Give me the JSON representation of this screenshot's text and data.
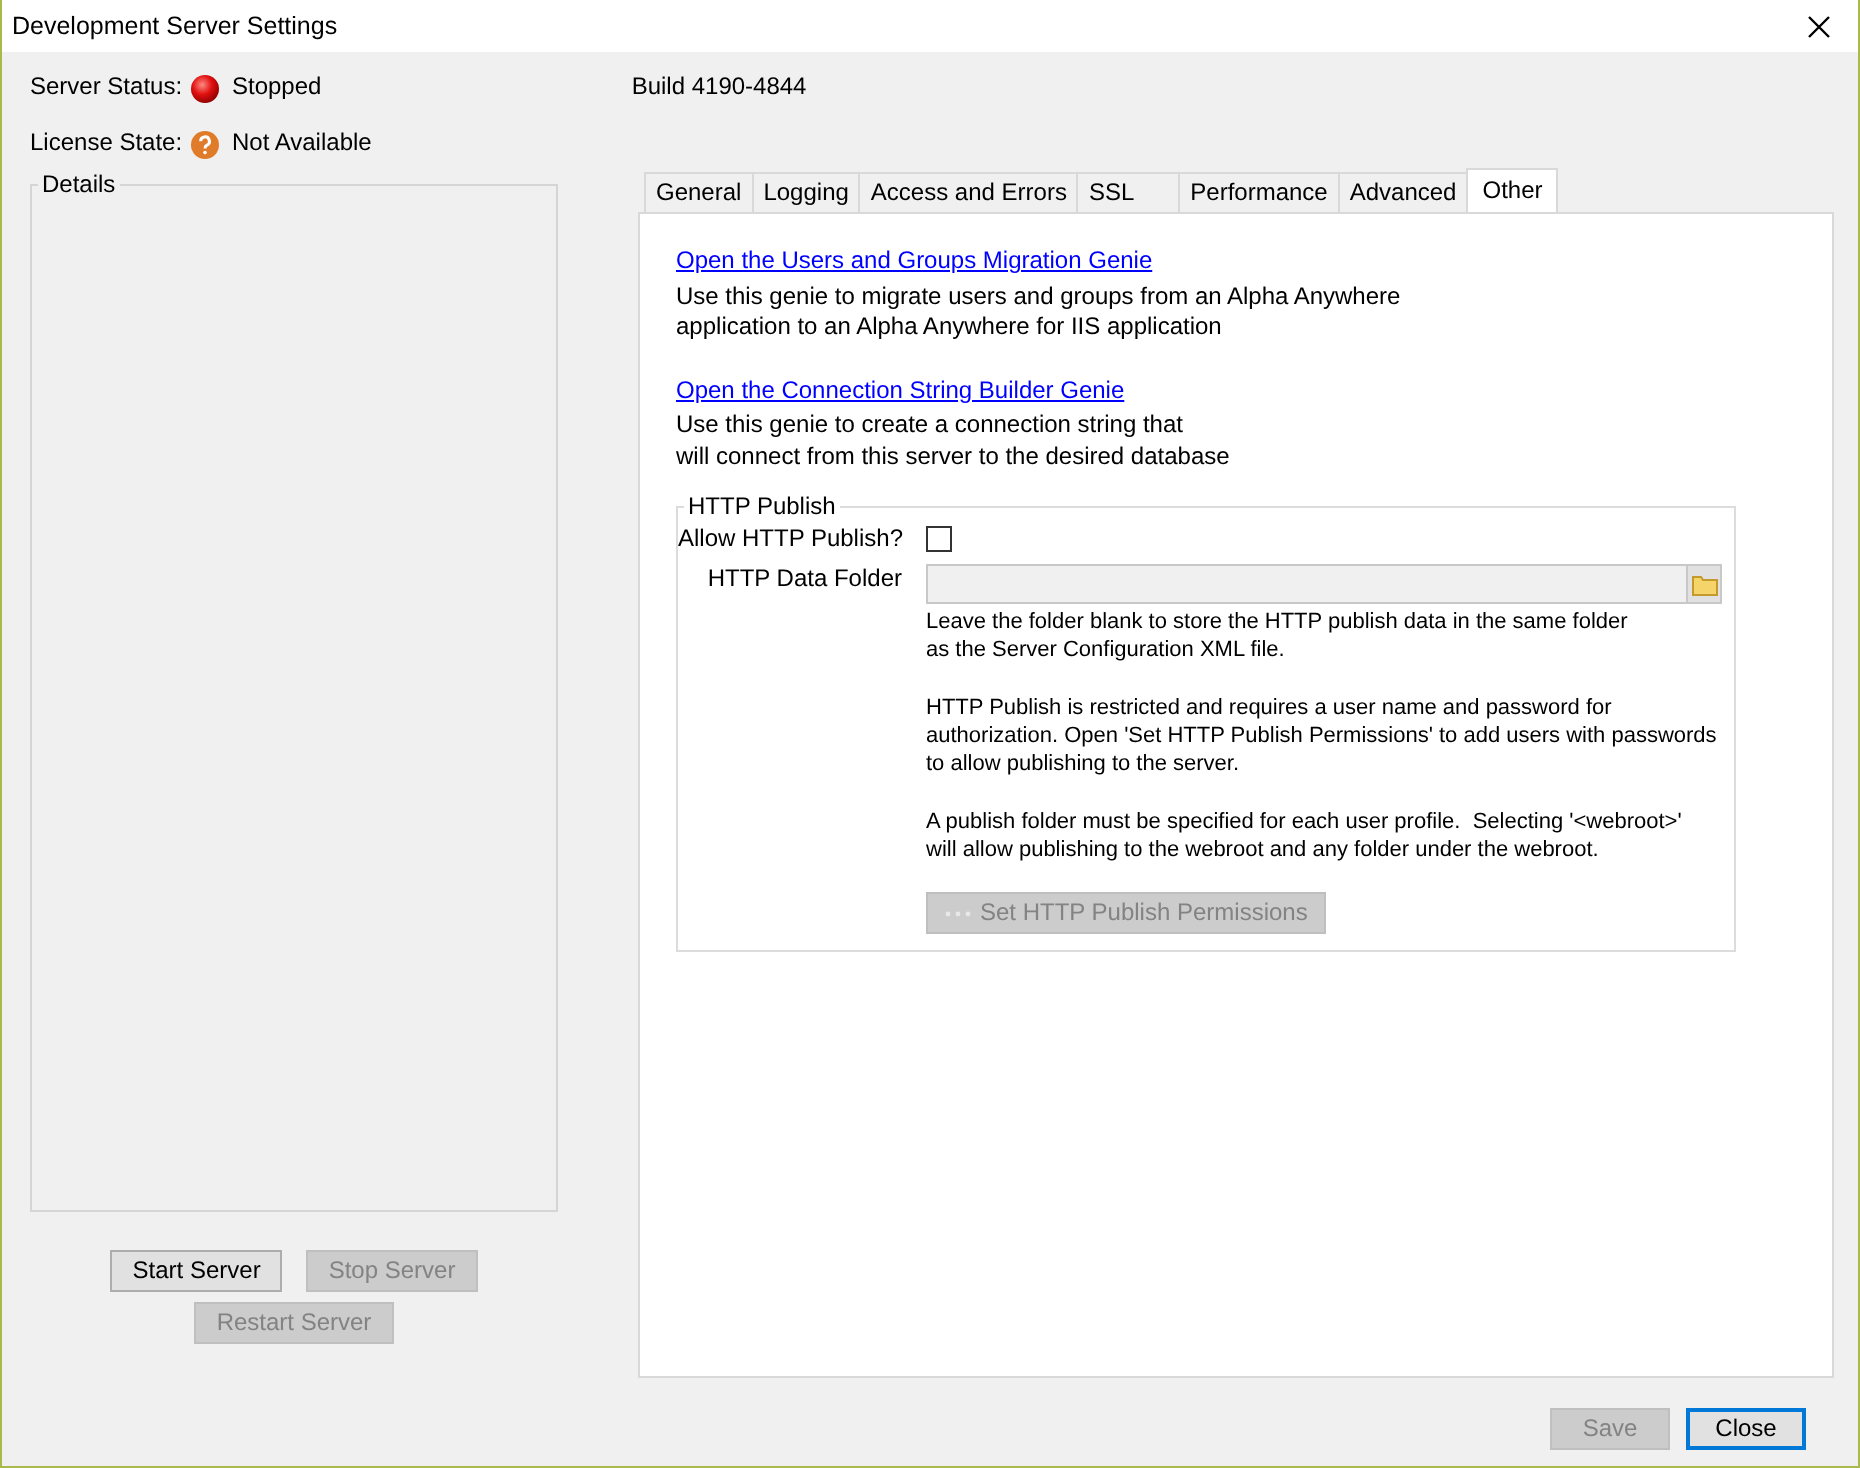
{
  "window": {
    "title": "Development Server Settings"
  },
  "status": [
    {
      "label": "Server Status:",
      "value": "Stopped",
      "kind": "stopped"
    },
    {
      "label": "License State:",
      "value": "Not Available",
      "kind": "unknown"
    }
  ],
  "build": "Build 4190-4844",
  "details": {
    "title": "Details"
  },
  "server_buttons": [
    {
      "label": "Start Server",
      "disabled": false
    },
    {
      "label": "Stop Server",
      "disabled": true
    },
    {
      "label": "Restart Server",
      "disabled": true
    }
  ],
  "tabs": [
    {
      "label": "General",
      "selected": false
    },
    {
      "label": "Logging",
      "selected": false
    },
    {
      "label": "Access and Errors",
      "selected": false
    },
    {
      "label": "SSL",
      "selected": false
    },
    {
      "label": "Performance",
      "selected": false
    },
    {
      "label": "Advanced",
      "selected": false
    },
    {
      "label": "Other",
      "selected": true
    }
  ],
  "genies": [
    {
      "link": "Open the Users and Groups Migration Genie",
      "description": "Use this genie to migrate users and groups from an Alpha Anywhere\napplication to an Alpha Anywhere for IIS application"
    },
    {
      "link": "Open the Connection String Builder Genie",
      "description": "Use this genie to create a connection string that\nwill connect from this server to the desired database"
    }
  ],
  "http_publish": {
    "title": "HTTP Publish",
    "allow_label": "Allow HTTP Publish?",
    "allow_checked": false,
    "folder_label": "HTTP Data Folder",
    "notes": [
      "Leave the folder blank to store the HTTP publish data in the same folder\nas the Server Configuration XML file.",
      "HTTP Publish is restricted and requires a user name and password for\nauthorization. Open 'Set HTTP Publish Permissions' to add users with passwords\nto allow publishing to the server.",
      "A publish folder must be specified for each user profile.  Selecting '<webroot>'\nwill allow publishing to the webroot and any folder under the webroot."
    ],
    "permissions_button": {
      "label": "Set HTTP Publish Permissions",
      "disabled": true
    }
  },
  "footer_buttons": [
    {
      "label": "Save",
      "disabled": true,
      "default": false
    },
    {
      "label": "Close",
      "disabled": false,
      "default": true
    }
  ]
}
